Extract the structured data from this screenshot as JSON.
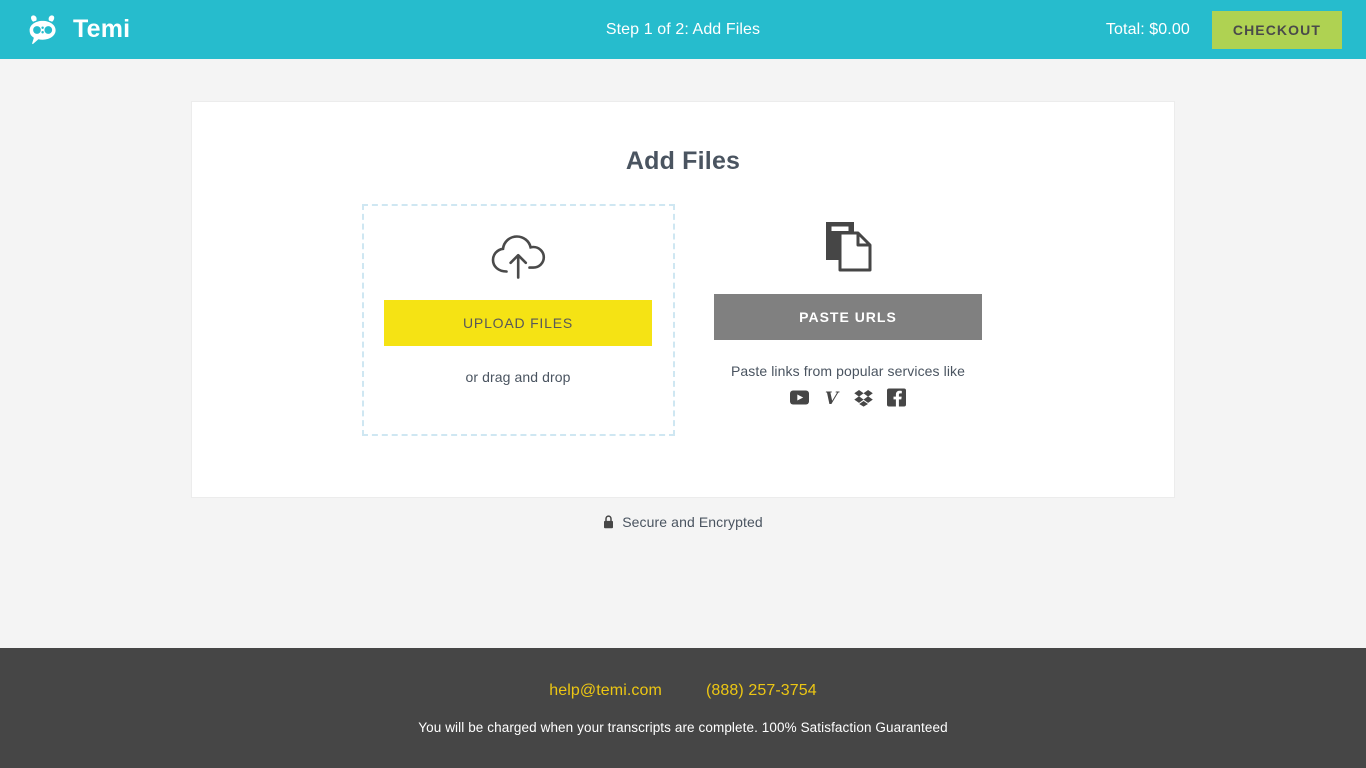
{
  "header": {
    "brand_name": "Temi",
    "logo_icon": "temi-robot-logo",
    "step_text": "Step 1 of 2: Add Files",
    "total_text": "Total: $0.00",
    "checkout_label": "CHECKOUT",
    "background_color": "#26bccd",
    "checkout_color": "#afd252"
  },
  "main": {
    "card_title": "Add Files",
    "upload": {
      "icon": "cloud-upload-icon",
      "button_label": "UPLOAD FILES",
      "button_color": "#f5e314",
      "drag_hint": "or drag and drop",
      "border_color": "#cfe7f2"
    },
    "paste": {
      "icon": "documents-icon",
      "button_label": "PASTE URLS",
      "button_color": "#808080",
      "hint": "Paste links from popular services like",
      "services": [
        {
          "name": "youtube-icon",
          "label": "YouTube"
        },
        {
          "name": "vimeo-icon",
          "label": "Vimeo"
        },
        {
          "name": "dropbox-icon",
          "label": "Dropbox"
        },
        {
          "name": "facebook-icon",
          "label": "Facebook"
        }
      ]
    },
    "secure_note": "Secure and Encrypted",
    "secure_icon": "lock-icon"
  },
  "footer": {
    "email": "help@temi.com",
    "phone": "(888) 257-3754",
    "note": "You will be charged when your transcripts are complete. 100% Satisfaction Guaranteed",
    "background_color": "#464646",
    "link_color": "#ecc613"
  }
}
